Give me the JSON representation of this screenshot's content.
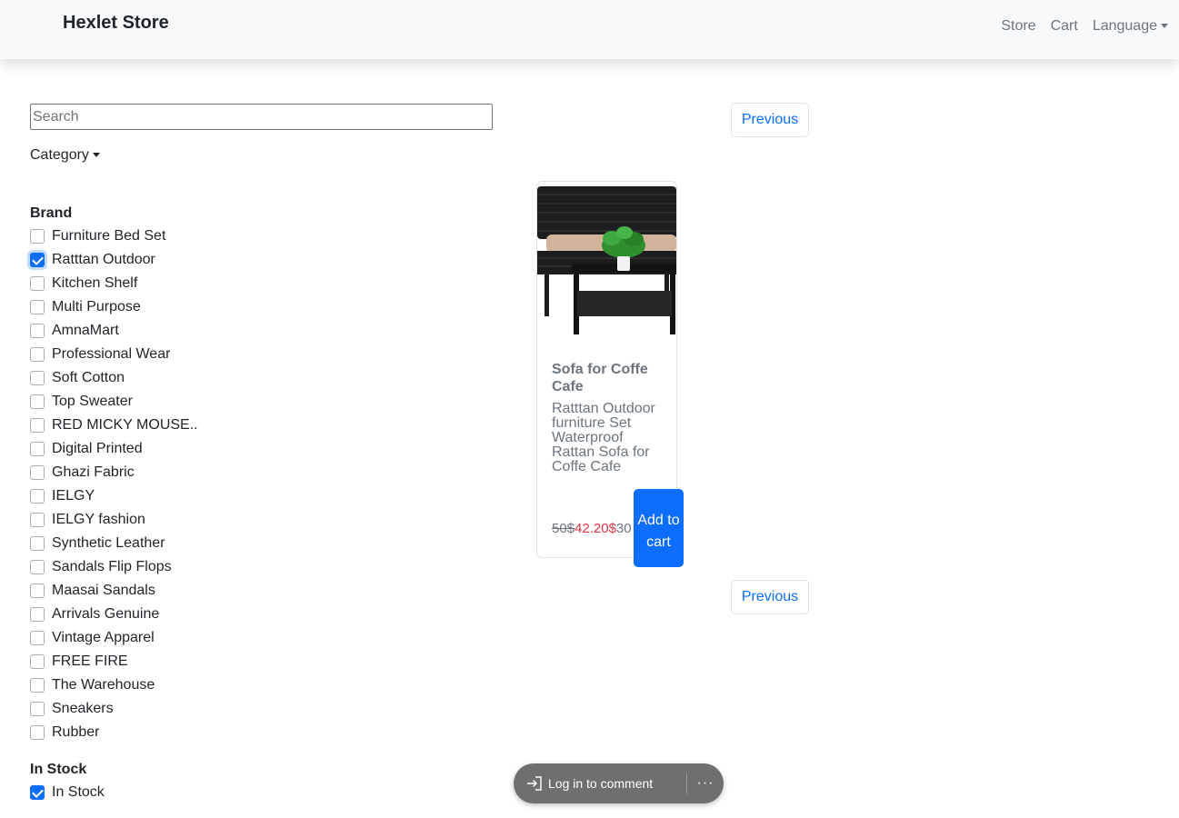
{
  "navbar": {
    "brand": "Hexlet Store",
    "links": [
      "Store",
      "Cart"
    ],
    "language": "Language"
  },
  "search": {
    "placeholder": "Search",
    "value": ""
  },
  "category": {
    "label": "Category"
  },
  "brand_filter": {
    "heading": "Brand",
    "items": [
      {
        "label": "Furniture Bed Set",
        "checked": false
      },
      {
        "label": "Ratttan Outdoor",
        "checked": true
      },
      {
        "label": "Kitchen Shelf",
        "checked": false
      },
      {
        "label": "Multi Purpose",
        "checked": false
      },
      {
        "label": "AmnaMart",
        "checked": false
      },
      {
        "label": "Professional Wear",
        "checked": false
      },
      {
        "label": "Soft Cotton",
        "checked": false
      },
      {
        "label": "Top Sweater",
        "checked": false
      },
      {
        "label": "RED MICKY MOUSE..",
        "checked": false
      },
      {
        "label": "Digital Printed",
        "checked": false
      },
      {
        "label": "Ghazi Fabric",
        "checked": false
      },
      {
        "label": "IELGY",
        "checked": false
      },
      {
        "label": "IELGY fashion",
        "checked": false
      },
      {
        "label": "Synthetic Leather",
        "checked": false
      },
      {
        "label": "Sandals Flip Flops",
        "checked": false
      },
      {
        "label": "Maasai Sandals",
        "checked": false
      },
      {
        "label": "Arrivals Genuine",
        "checked": false
      },
      {
        "label": "Vintage Apparel",
        "checked": false
      },
      {
        "label": "FREE FIRE",
        "checked": false
      },
      {
        "label": "The Warehouse",
        "checked": false
      },
      {
        "label": "Sneakers",
        "checked": false
      },
      {
        "label": "Rubber",
        "checked": false
      }
    ]
  },
  "stock_filter": {
    "heading": "In Stock",
    "item": {
      "label": "In Stock",
      "checked": true
    }
  },
  "pagination": {
    "previous_label": "Previous"
  },
  "product": {
    "title": "Sofa for Coffe Cafe",
    "description": "Ratttan Outdoor furniture Set Waterproof Rattan Sofa for Coffe Cafe",
    "old_price": "50$",
    "new_price": "42.20$",
    "extra_price": "30",
    "add_to_cart": "Add to cart",
    "image_icon": "rattan-sofa-set-image"
  },
  "comment_bar": {
    "login_label": "Log in to comment",
    "more_label": "···"
  },
  "colors": {
    "primary": "#0d6efd",
    "sale": "#dc3545",
    "muted": "#6c757d",
    "navbar_bg": "#f8f9fa",
    "pill_bg": "#6f6f6f"
  }
}
